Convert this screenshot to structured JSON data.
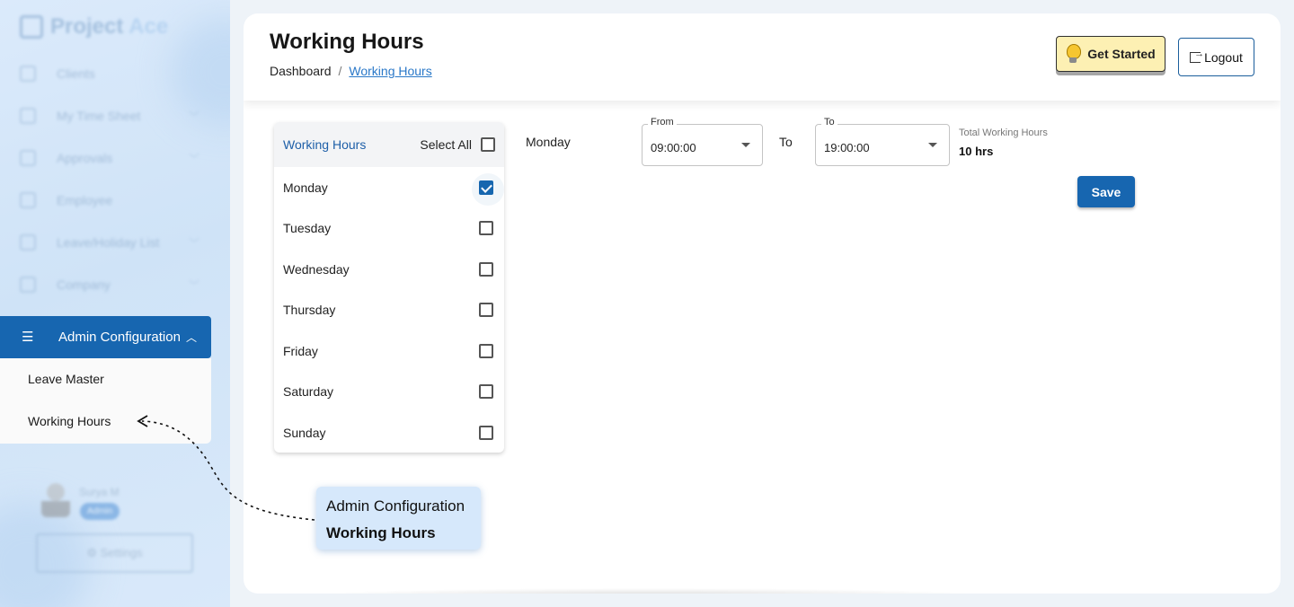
{
  "sidebar": {
    "brand": {
      "name": "Project",
      "accent": "Ace"
    },
    "nav_items": [
      {
        "label": "Clients",
        "icon": "clients-icon",
        "has_chevron": false
      },
      {
        "label": "My Time Sheet",
        "icon": "timesheet-icon",
        "has_chevron": true
      },
      {
        "label": "Approvals",
        "icon": "calendar-icon",
        "has_chevron": true
      },
      {
        "label": "Employee",
        "icon": "employee-icon",
        "has_chevron": false
      },
      {
        "label": "Leave/Holiday List",
        "icon": "list-icon",
        "has_chevron": true
      },
      {
        "label": "Company",
        "icon": "company-icon",
        "has_chevron": true
      }
    ],
    "active_group": {
      "label": "Admin Configuration",
      "icon": "sliders-icon"
    },
    "submenu": [
      "Leave Master",
      "Working Hours"
    ],
    "profile": {
      "name": "Surya M",
      "role": "Admin"
    },
    "settings_label": "⚙ Settings"
  },
  "header": {
    "title": "Working Hours",
    "breadcrumb": {
      "root": "Dashboard",
      "separator": "/",
      "current": "Working Hours"
    },
    "get_started_label": "Get Started",
    "logout_label": "Logout"
  },
  "days_panel": {
    "header_title": "Working Hours",
    "select_all_label": "Select All",
    "days": [
      {
        "label": "Monday",
        "checked": true
      },
      {
        "label": "Tuesday",
        "checked": false
      },
      {
        "label": "Wednesday",
        "checked": false
      },
      {
        "label": "Thursday",
        "checked": false
      },
      {
        "label": "Friday",
        "checked": false
      },
      {
        "label": "Saturday",
        "checked": false
      },
      {
        "label": "Sunday",
        "checked": false
      }
    ]
  },
  "editor": {
    "day": "Monday",
    "from": {
      "legend": "From",
      "value": "09:00:00"
    },
    "to_label": "To",
    "to": {
      "legend": "To",
      "value": "19:00:00"
    },
    "total_label": "Total Working Hours",
    "total_value": "10 hrs",
    "save_label": "Save"
  },
  "callout": {
    "line1": "Admin Configuration",
    "line2": "Working Hours"
  },
  "colors": {
    "primary": "#1766b0",
    "link": "#2a78c8",
    "get_started_bg": "#fdf0b3",
    "callout_bg": "#d6e8fb"
  }
}
